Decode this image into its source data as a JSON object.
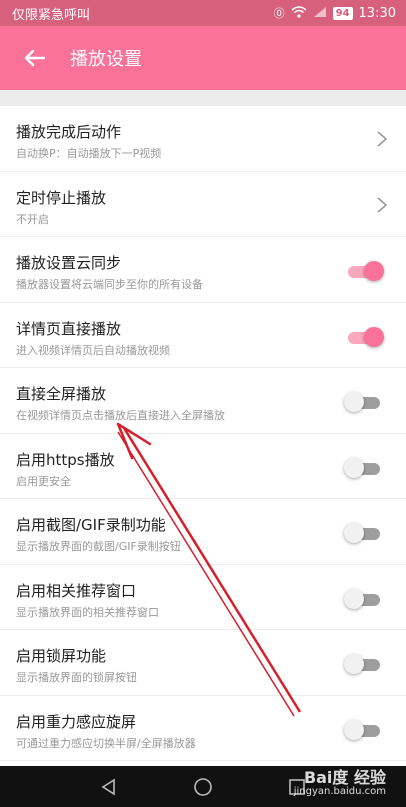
{
  "status_bar": {
    "carrier": "仅限紧急呼叫",
    "battery": "94",
    "time": "13:30"
  },
  "toolbar": {
    "title": "播放设置"
  },
  "settings": [
    {
      "title": "播放完成后动作",
      "subtitle": "自动换P：自动播放下一P视频",
      "control": "chevron"
    },
    {
      "title": "定时停止播放",
      "subtitle": "不开启",
      "control": "chevron"
    },
    {
      "title": "播放设置云同步",
      "subtitle": "播放器设置将云端同步至你的所有设备",
      "control": "switch",
      "on": true
    },
    {
      "title": "详情页直接播放",
      "subtitle": "进入视频详情页后自动播放视频",
      "control": "switch",
      "on": true
    },
    {
      "title": "直接全屏播放",
      "subtitle": "在视频详情页点击播放后直接进入全屏播放",
      "control": "switch",
      "on": false
    },
    {
      "title": "启用https播放",
      "subtitle": "启用更安全",
      "control": "switch",
      "on": false
    },
    {
      "title": "启用截图/GIF录制功能",
      "subtitle": "显示播放界面的截图/GIF录制按钮",
      "control": "switch",
      "on": false
    },
    {
      "title": "启用相关推荐窗口",
      "subtitle": "显示播放界面的相关推荐窗口",
      "control": "switch",
      "on": false
    },
    {
      "title": "启用锁屏功能",
      "subtitle": "显示播放界面的锁屏按钮",
      "control": "switch",
      "on": false
    },
    {
      "title": "启用重力感应旋屏",
      "subtitle": "可通过重力感应切换半屏/全屏播放器",
      "control": "switch",
      "on": false
    }
  ],
  "colors": {
    "status_bar": "#d7607c",
    "toolbar": "#fb7299",
    "switch_on": "#fb7299",
    "annotation_arrow": "#d4202a"
  },
  "watermark": {
    "brand": "Bai度 经验",
    "url": "jingyan.baidu.com"
  }
}
